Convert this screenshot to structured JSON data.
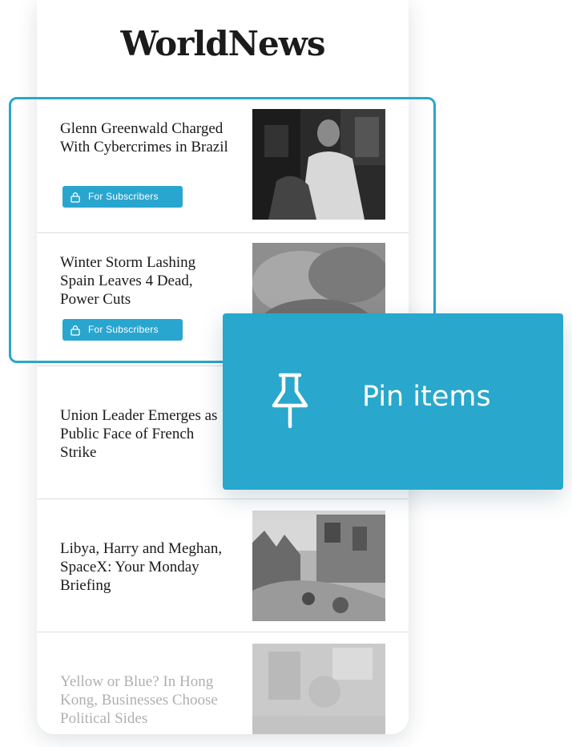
{
  "app": {
    "logo": "WorldNews"
  },
  "articles": [
    {
      "headline": "Glenn Greenwald Charged With Cybercrimes in Brazil",
      "badge": "For Subscribers"
    },
    {
      "headline": "Winter Storm Lashing Spain Leaves 4 Dead, Power Cuts",
      "badge": "For Subscribers"
    },
    {
      "headline": "Union Leader Emerges as Public Face of French Strike"
    },
    {
      "headline": "Libya, Harry and Meghan, SpaceX: Your Monday Briefing"
    },
    {
      "headline": "Yellow or Blue? In Hong Kong, Businesses Choose Political Sides"
    }
  ],
  "pin_tooltip": {
    "label": "Pin items",
    "icon": "pushpin-icon"
  },
  "colors": {
    "accent": "#2aa7cc",
    "text": "#1a1a1a",
    "divider": "#dcdcdc"
  }
}
